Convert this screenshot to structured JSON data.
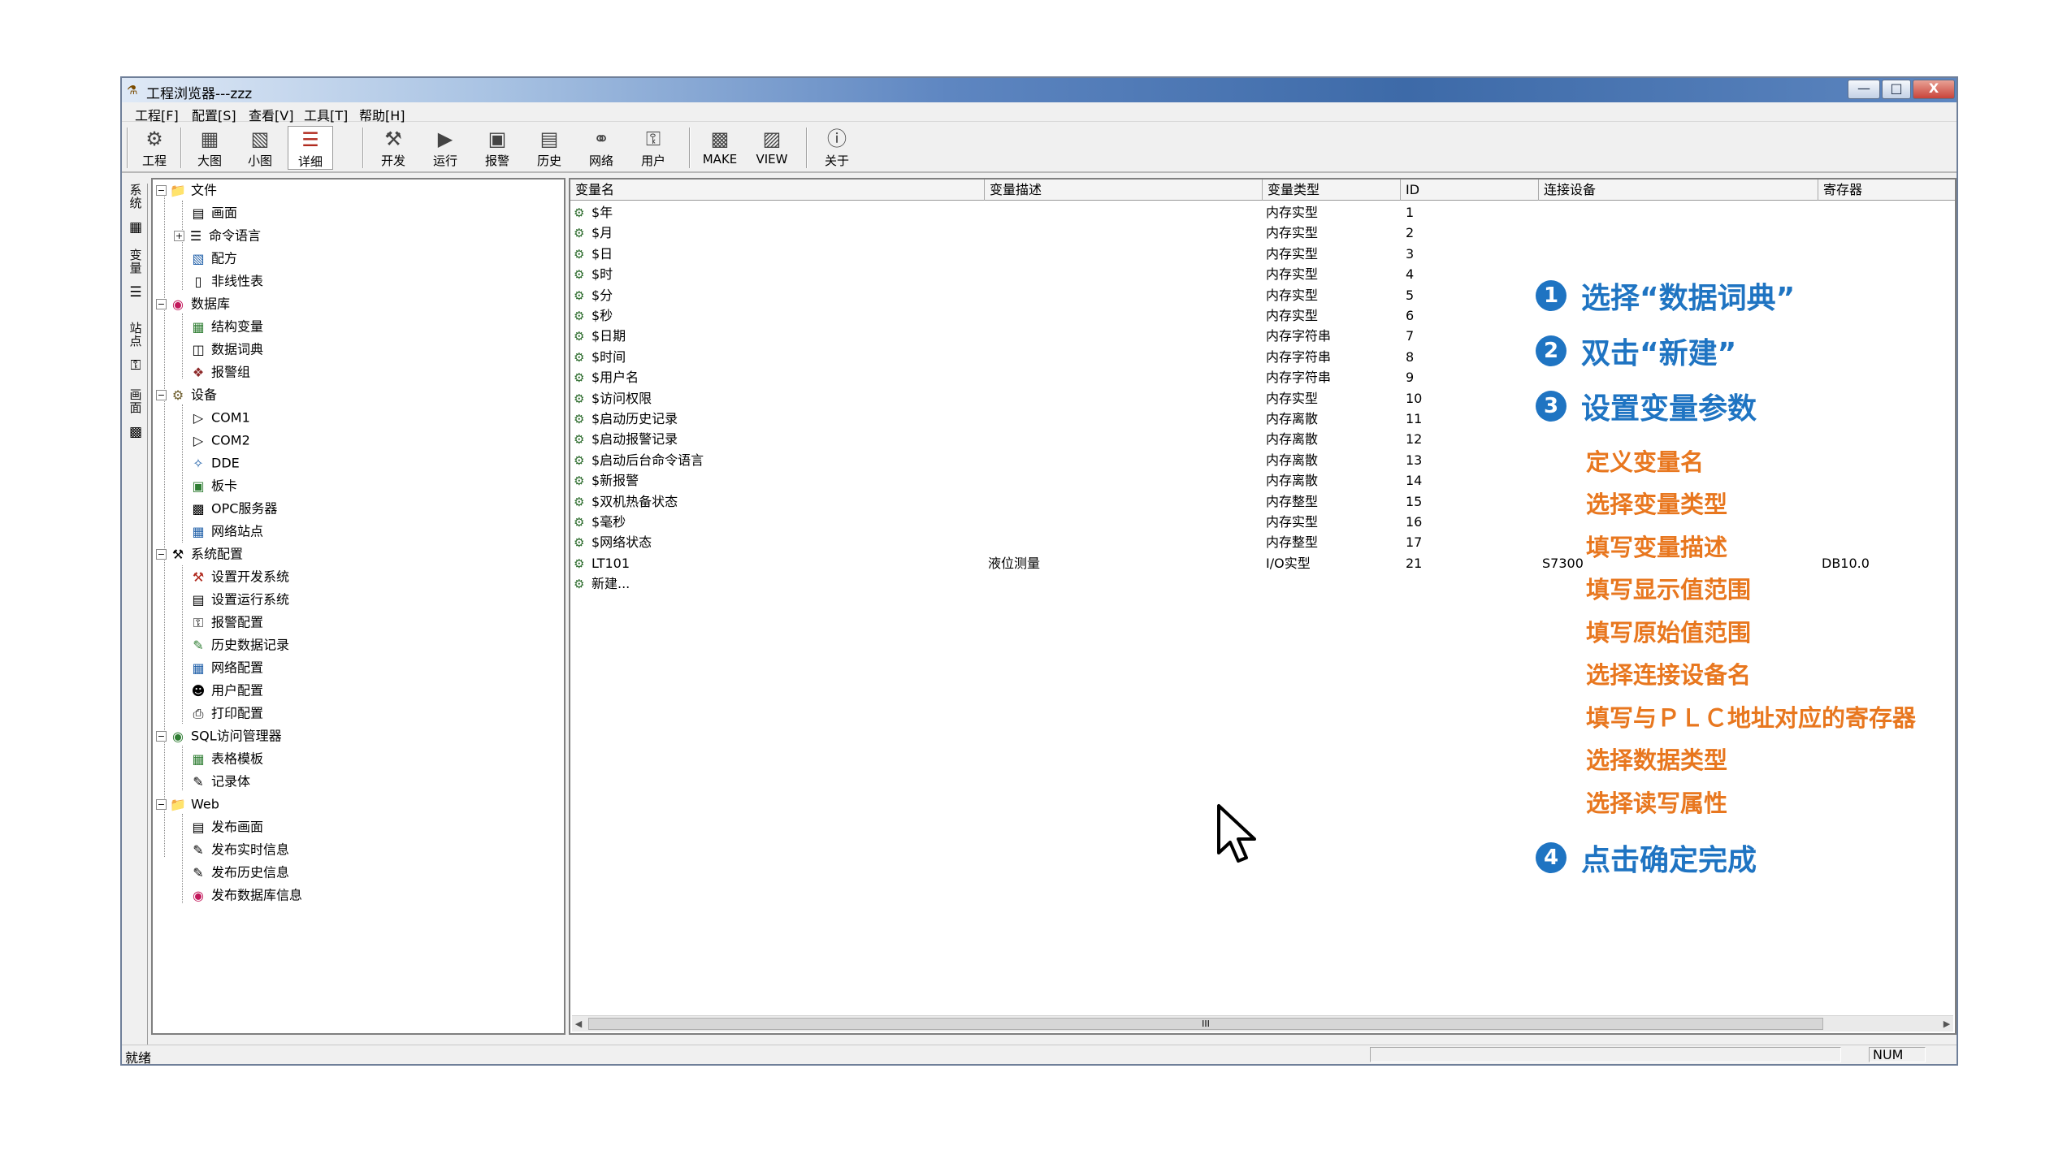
{
  "window": {
    "title": "工程浏览器---zzz",
    "buttons": [
      "—",
      "□",
      "X"
    ]
  },
  "menu": [
    "工程[F]",
    "配置[S]",
    "查看[V]",
    "工具[T]",
    "帮助[H]"
  ],
  "toolbar": [
    {
      "label": "工程",
      "icon": "project-icon"
    },
    {
      "label": "大图",
      "icon": "large-icon-view-icon"
    },
    {
      "label": "小图",
      "icon": "small-icon-view-icon"
    },
    {
      "label": "详细",
      "icon": "detail-view-icon"
    },
    {
      "label": "开发",
      "icon": "develop-icon"
    },
    {
      "label": "运行",
      "icon": "run-icon"
    },
    {
      "label": "报警",
      "icon": "alarm-icon"
    },
    {
      "label": "历史",
      "icon": "history-icon"
    },
    {
      "label": "网络",
      "icon": "network-icon"
    },
    {
      "label": "用户",
      "icon": "user-icon"
    },
    {
      "label": "MAKE",
      "icon": "make-icon"
    },
    {
      "label": "VIEW",
      "icon": "view-icon"
    },
    {
      "label": "关于",
      "icon": "about-icon"
    }
  ],
  "side_tabs": [
    "系统",
    "变量",
    "站点",
    "画面"
  ],
  "tree": [
    {
      "label": "文件",
      "icon": "folder-icon"
    },
    {
      "label": "画面",
      "icon": "screen-icon"
    },
    {
      "label": "命令语言",
      "icon": "command-language-icon"
    },
    {
      "label": "配方",
      "icon": "recipe-icon"
    },
    {
      "label": "非线性表",
      "icon": "nonlinear-table-icon"
    },
    {
      "label": "数据库",
      "icon": "database-icon"
    },
    {
      "label": "结构变量",
      "icon": "struct-variable-icon"
    },
    {
      "label": "数据词典",
      "icon": "data-dictionary-icon"
    },
    {
      "label": "报警组",
      "icon": "alarm-group-icon"
    },
    {
      "label": "设备",
      "icon": "device-icon"
    },
    {
      "label": "COM1",
      "icon": "com-port-icon"
    },
    {
      "label": "COM2",
      "icon": "com-port-icon"
    },
    {
      "label": "DDE",
      "icon": "dde-icon"
    },
    {
      "label": "板卡",
      "icon": "board-card-icon"
    },
    {
      "label": "OPC服务器",
      "icon": "opc-server-icon"
    },
    {
      "label": "网络站点",
      "icon": "network-station-icon"
    },
    {
      "label": "系统配置",
      "icon": "system-config-icon"
    },
    {
      "label": "设置开发系统",
      "icon": "dev-system-icon"
    },
    {
      "label": "设置运行系统",
      "icon": "run-system-icon"
    },
    {
      "label": "报警配置",
      "icon": "alarm-config-icon"
    },
    {
      "label": "历史数据记录",
      "icon": "history-record-icon"
    },
    {
      "label": "网络配置",
      "icon": "network-config-icon"
    },
    {
      "label": "用户配置",
      "icon": "user-config-icon"
    },
    {
      "label": "打印配置",
      "icon": "print-config-icon"
    },
    {
      "label": "SQL访问管理器",
      "icon": "sql-manager-icon"
    },
    {
      "label": "表格模板",
      "icon": "table-template-icon"
    },
    {
      "label": "记录体",
      "icon": "record-icon"
    },
    {
      "label": "Web",
      "icon": "folder-icon"
    },
    {
      "label": "发布画面",
      "icon": "publish-screen-icon"
    },
    {
      "label": "发布实时信息",
      "icon": "publish-realtime-icon"
    },
    {
      "label": "发布历史信息",
      "icon": "publish-history-icon"
    },
    {
      "label": "发布数据库信息",
      "icon": "publish-database-icon"
    }
  ],
  "table": {
    "columns": [
      "变量名",
      "变量描述",
      "变量类型",
      "ID",
      "连接设备",
      "寄存器"
    ],
    "rows": [
      {
        "name": "$年",
        "desc": "",
        "type": "内存实型",
        "id": "1",
        "device": "",
        "register": ""
      },
      {
        "name": "$月",
        "desc": "",
        "type": "内存实型",
        "id": "2",
        "device": "",
        "register": ""
      },
      {
        "name": "$日",
        "desc": "",
        "type": "内存实型",
        "id": "3",
        "device": "",
        "register": ""
      },
      {
        "name": "$时",
        "desc": "",
        "type": "内存实型",
        "id": "4",
        "device": "",
        "register": ""
      },
      {
        "name": "$分",
        "desc": "",
        "type": "内存实型",
        "id": "5",
        "device": "",
        "register": ""
      },
      {
        "name": "$秒",
        "desc": "",
        "type": "内存实型",
        "id": "6",
        "device": "",
        "register": ""
      },
      {
        "name": "$日期",
        "desc": "",
        "type": "内存字符串",
        "id": "7",
        "device": "",
        "register": ""
      },
      {
        "name": "$时间",
        "desc": "",
        "type": "内存字符串",
        "id": "8",
        "device": "",
        "register": ""
      },
      {
        "name": "$用户名",
        "desc": "",
        "type": "内存字符串",
        "id": "9",
        "device": "",
        "register": ""
      },
      {
        "name": "$访问权限",
        "desc": "",
        "type": "内存实型",
        "id": "10",
        "device": "",
        "register": ""
      },
      {
        "name": "$启动历史记录",
        "desc": "",
        "type": "内存离散",
        "id": "11",
        "device": "",
        "register": ""
      },
      {
        "name": "$启动报警记录",
        "desc": "",
        "type": "内存离散",
        "id": "12",
        "device": "",
        "register": ""
      },
      {
        "name": "$启动后台命令语言",
        "desc": "",
        "type": "内存离散",
        "id": "13",
        "device": "",
        "register": ""
      },
      {
        "name": "$新报警",
        "desc": "",
        "type": "内存离散",
        "id": "14",
        "device": "",
        "register": ""
      },
      {
        "name": "$双机热备状态",
        "desc": "",
        "type": "内存整型",
        "id": "15",
        "device": "",
        "register": ""
      },
      {
        "name": "$毫秒",
        "desc": "",
        "type": "内存实型",
        "id": "16",
        "device": "",
        "register": ""
      },
      {
        "name": "$网络状态",
        "desc": "",
        "type": "内存整型",
        "id": "17",
        "device": "",
        "register": ""
      },
      {
        "name": "LT101",
        "desc": "液位测量",
        "type": "I/O实型",
        "id": "21",
        "device": "S7300",
        "register": "DB10.0"
      },
      {
        "name": "新建...",
        "desc": "",
        "type": "",
        "id": "",
        "device": "",
        "register": ""
      }
    ]
  },
  "scrollbar_thumb": "III",
  "status": {
    "text": "就绪",
    "num": "NUM"
  },
  "annotations": {
    "steps": [
      {
        "num": "1",
        "text": "选择“数据词典”"
      },
      {
        "num": "2",
        "text": "双击“新建”"
      },
      {
        "num": "3",
        "text": "设置变量参数"
      },
      {
        "num": "4",
        "text": "点击确定完成"
      }
    ],
    "substeps": [
      "定义变量名",
      "选择变量类型",
      "填写变量描述",
      "填写显示值范围",
      "填写原始值范围",
      "选择连接设备名",
      "填写与ＰＬＣ地址对应的寄存器",
      "选择数据类型",
      "选择读写属性"
    ]
  },
  "colors": {
    "step_blue": "#1f74c2",
    "substep_orange": "#e8771f",
    "titlebar_blue": "#3d6aa8"
  }
}
